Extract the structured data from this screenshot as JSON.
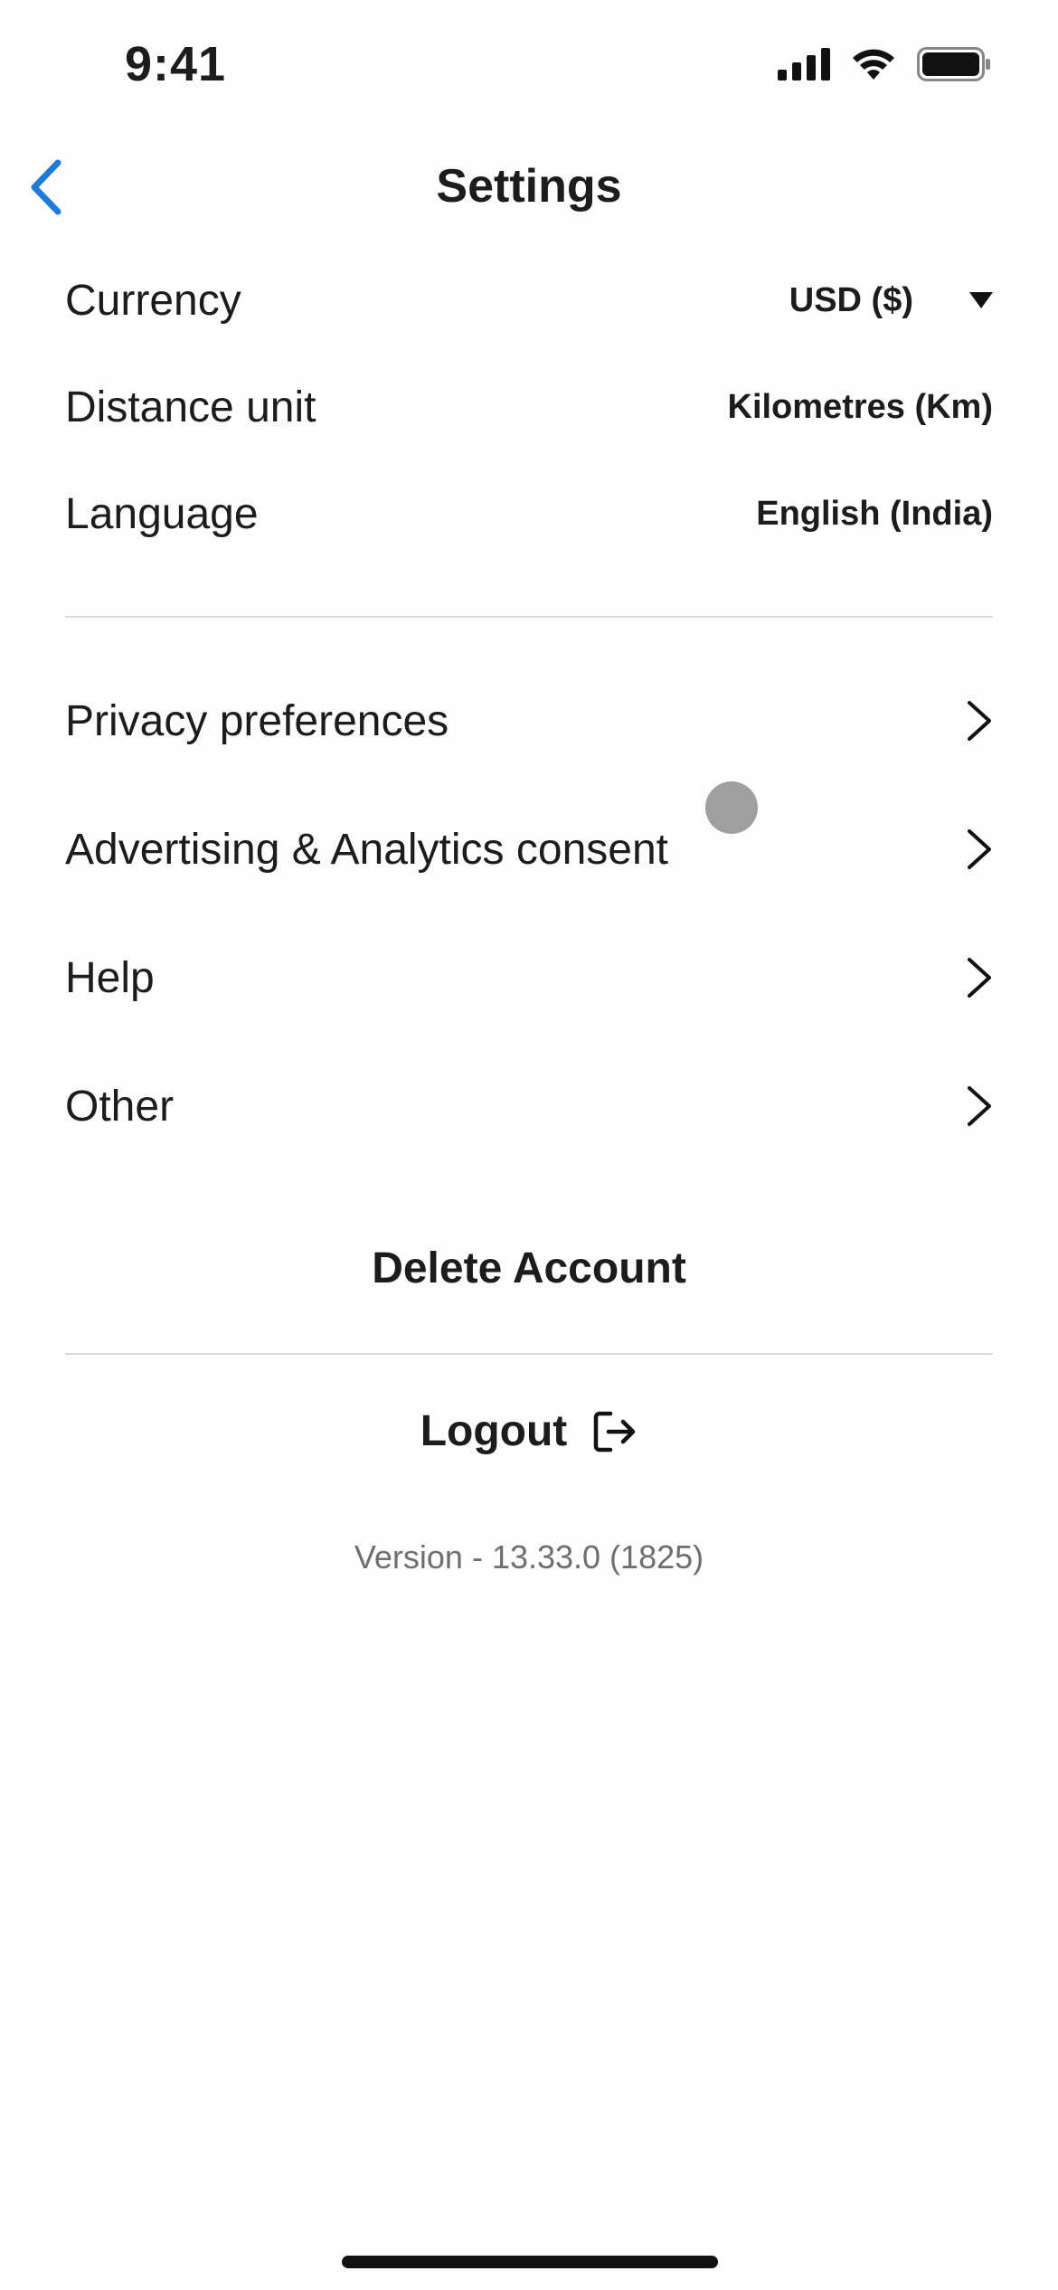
{
  "status_bar": {
    "time": "9:41"
  },
  "header": {
    "title": "Settings",
    "back_icon": "chevron-left-icon"
  },
  "preferences": [
    {
      "id": "currency",
      "label": "Currency",
      "value": "USD ($)"
    },
    {
      "id": "distance",
      "label": "Distance unit",
      "value": "Kilometres (Km)"
    },
    {
      "id": "language",
      "label": "Language",
      "value": "English (India)"
    }
  ],
  "menu": [
    {
      "id": "privacy",
      "label": "Privacy preferences"
    },
    {
      "id": "advertising",
      "label": "Advertising & Analytics consent"
    },
    {
      "id": "help",
      "label": "Help"
    },
    {
      "id": "other",
      "label": "Other"
    }
  ],
  "actions": {
    "delete_account": "Delete Account",
    "logout": "Logout"
  },
  "footer": {
    "version": "Version - 13.33.0 (1825)"
  },
  "colors": {
    "accent": "#1e7bd7",
    "text": "#1c1c1e",
    "muted": "#6e6e73",
    "divider": "#dcdcdc"
  }
}
